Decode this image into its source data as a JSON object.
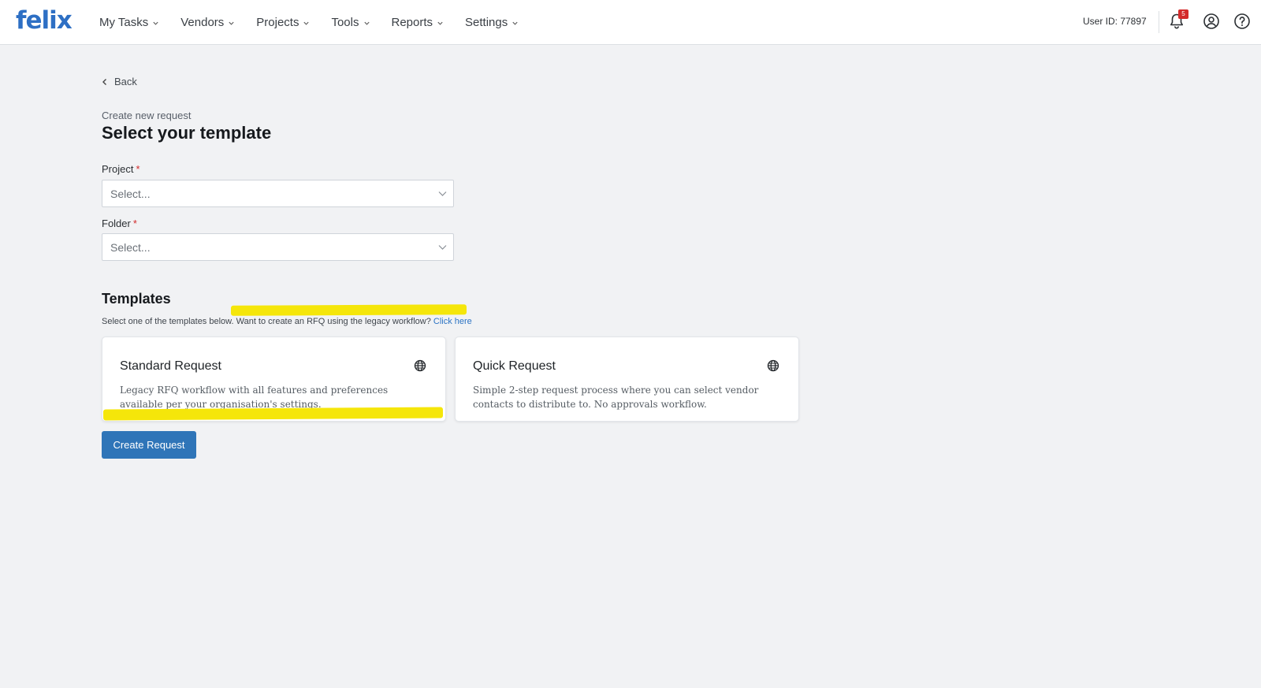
{
  "brand": {
    "logo_text": "felix",
    "color": "#2d6fc4"
  },
  "nav": {
    "items": [
      {
        "label": "My Tasks"
      },
      {
        "label": "Vendors"
      },
      {
        "label": "Projects"
      },
      {
        "label": "Tools"
      },
      {
        "label": "Reports"
      },
      {
        "label": "Settings"
      }
    ]
  },
  "header": {
    "user_id": "User ID: 77897",
    "notification_count": "5",
    "icons": [
      "bell-icon",
      "user-circle-icon",
      "help-icon"
    ]
  },
  "page": {
    "back_label": "Back",
    "subtitle": "Create new request",
    "title": "Select your template"
  },
  "form": {
    "project": {
      "label": "Project",
      "required_mark": "*",
      "placeholder": "Select..."
    },
    "folder": {
      "label": "Folder",
      "required_mark": "*",
      "placeholder": "Select..."
    }
  },
  "templates": {
    "heading": "Templates",
    "description": "Select one of the templates below. Want to create an RFQ using the legacy workflow?",
    "link_text": "Click here",
    "cards": [
      {
        "title": "Standard Request",
        "description": "Legacy RFQ workflow with all features and preferences available per your organisation's settings.",
        "icon": "globe-icon"
      },
      {
        "title": "Quick Request",
        "description": "Simple 2-step request process where you can select vendor contacts to distribute to. No approvals workflow.",
        "icon": "globe-icon"
      }
    ]
  },
  "actions": {
    "create_label": "Create Request",
    "color": "#2f75b8"
  },
  "annotations": {
    "highlight_color": "#f5e60a"
  }
}
